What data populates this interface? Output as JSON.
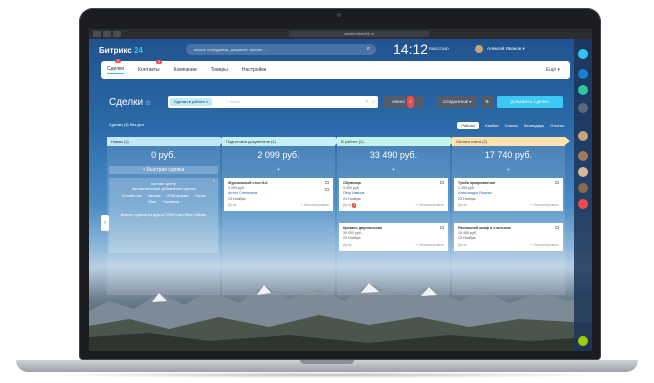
{
  "browser": {
    "url": "vanillo.bitrix24.ru"
  },
  "app": {
    "logo_main": "Битрикс",
    "logo_num": "24"
  },
  "search": {
    "placeholder": "искать сотрудника, документ, прочее..."
  },
  "clock": {
    "time": "14:12",
    "status": "РАБОТАЮ"
  },
  "user": {
    "name": "Алексей Иванов ▾"
  },
  "menu": {
    "items": [
      {
        "label": "Сделки",
        "badge": "2"
      },
      {
        "label": "Контакты",
        "badge": "3"
      },
      {
        "label": "Компании"
      },
      {
        "label": "Товары"
      },
      {
        "label": "Настройки"
      }
    ],
    "more": "Ещё ▾"
  },
  "page": {
    "title": "Сделки",
    "filter_tag": "Сделки в работе  ×",
    "filter_placeholder": "+ поиск",
    "btn_more": "МЕНЮ",
    "btn_more_badge": "2",
    "btn_created": "СОЗДАННЫЕ ▾",
    "btn_add": "ДОБАВИТЬ СДЕЛКУ"
  },
  "subbar": {
    "left": "Сделки  (3)  без дел",
    "views": [
      "Работы",
      "Канбан",
      "Список",
      "Календарь",
      "Отчеты"
    ]
  },
  "columns": [
    {
      "name": "Новая (1)",
      "sum": "0 руб.",
      "color": "#2fc6f6",
      "add": "+ Быстрая сделка"
    },
    {
      "name": "Подготовка документов (1)",
      "sum": "2 099 руб.",
      "color": "#55d0e0",
      "add": "+"
    },
    {
      "name": "В работе (2)",
      "sum": "33 490 руб.",
      "color": "#47e4c2",
      "add": "+"
    },
    {
      "name": "Оплата счета (2)",
      "sum": "17 740 руб.",
      "color": "#ffa900",
      "add": "+"
    }
  ],
  "promo": {
    "title": "Контакт-центр",
    "subtitle": "Автоматическое добавление сделок",
    "channels": [
      "Онлайн-чат",
      "Звонки",
      "CRM-формы",
      "Почта",
      "Viber",
      "Facebook"
    ],
    "footer": "Импорт сделок из других CRM или Office-таблиц"
  },
  "cards": [
    {
      "title": "Журнальный стол №2",
      "sum": "2 099 руб.",
      "contact": "Антон Слепенков",
      "date": "23 Ноября",
      "deal": "Дела",
      "plan": "+ Запланировать"
    },
    {
      "title": "Обувница",
      "sum": "3 490 руб.",
      "contact": "Петр Иванов",
      "date": "23 Ноября",
      "deal": "Дела",
      "badge": "1",
      "plan": "+ Запланировать"
    },
    {
      "title": "Кровать двуспальная",
      "sum": "30 000 руб.",
      "contact": "",
      "date": "23 Ноября",
      "deal": "Дела",
      "plan": "+ Запланировать"
    },
    {
      "title": "Тумба прикроватная",
      "sum": "2 260 руб.",
      "contact": "Александра Яшенко",
      "date": "23 Ноября",
      "deal": "Дела",
      "plan": "+ Запланировать"
    },
    {
      "title": "Распашной шкаф в стильном",
      "sum": "15 480 руб.",
      "contact": "",
      "date": "23 Ноября",
      "deal": "Дела",
      "plan": "+ Запланировать"
    }
  ],
  "right_panel": {
    "colors": [
      "#2fc6f6",
      "#1a7fd0",
      "#2fc6a0",
      "#f04b4b",
      "#9dcf00"
    ]
  }
}
